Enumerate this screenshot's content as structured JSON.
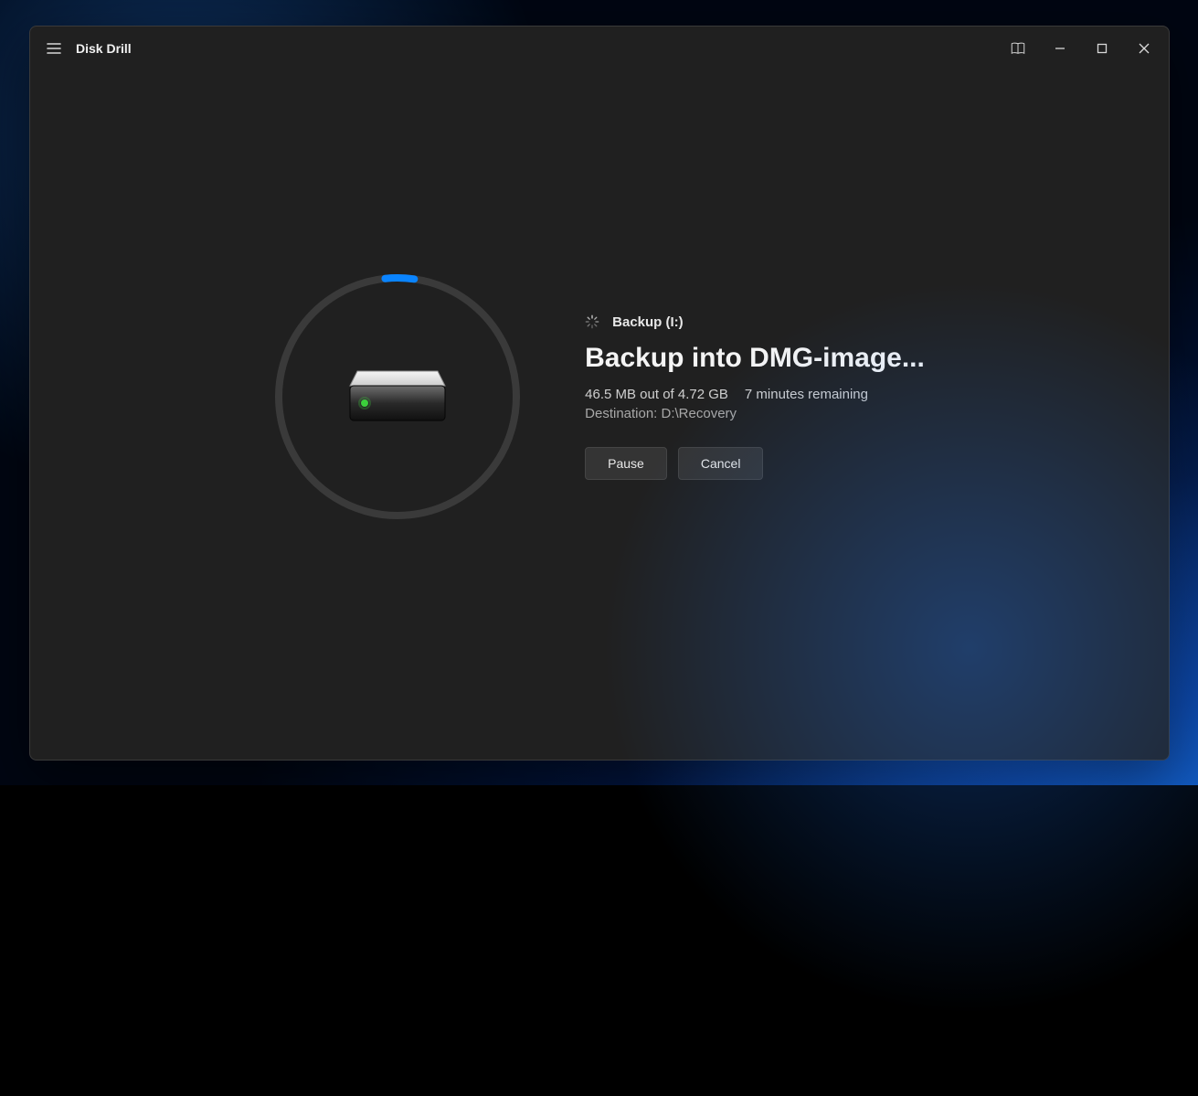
{
  "app": {
    "title": "Disk Drill"
  },
  "titlebar": {
    "docs_icon": "book-icon"
  },
  "backup": {
    "drive_label": "Backup (I:)",
    "headline": "Backup into DMG-image...",
    "progress_text": "46.5 MB out of 4.72 GB",
    "eta_text": "7 minutes remaining",
    "destination_text": "Destination: D:\\Recovery",
    "progress_percent": 4
  },
  "buttons": {
    "pause": "Pause",
    "cancel": "Cancel"
  }
}
